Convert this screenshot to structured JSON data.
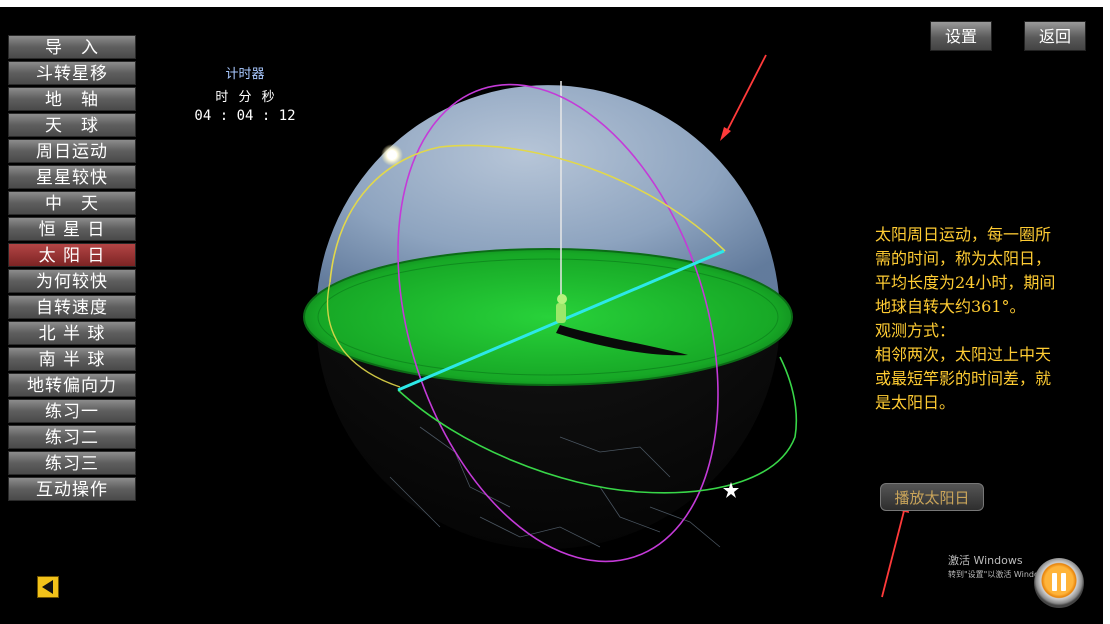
{
  "sidebar": {
    "items": [
      {
        "label": "导　入",
        "name": "sidebar-item-import"
      },
      {
        "label": "斗转星移",
        "name": "sidebar-item-star-movement"
      },
      {
        "label": "地　轴",
        "name": "sidebar-item-earth-axis"
      },
      {
        "label": "天　球",
        "name": "sidebar-item-celestial-sphere"
      },
      {
        "label": "周日运动",
        "name": "sidebar-item-diurnal-motion"
      },
      {
        "label": "星星较快",
        "name": "sidebar-item-stars-faster"
      },
      {
        "label": "中　天",
        "name": "sidebar-item-culmination"
      },
      {
        "label": "恒 星 日",
        "name": "sidebar-item-sidereal-day"
      },
      {
        "label": "太 阳 日",
        "name": "sidebar-item-solar-day",
        "active": true
      },
      {
        "label": "为何较快",
        "name": "sidebar-item-why-faster"
      },
      {
        "label": "自转速度",
        "name": "sidebar-item-rotation-speed"
      },
      {
        "label": "北 半 球",
        "name": "sidebar-item-northern-hemisphere"
      },
      {
        "label": "南 半 球",
        "name": "sidebar-item-southern-hemisphere"
      },
      {
        "label": "地转偏向力",
        "name": "sidebar-item-coriolis-force"
      },
      {
        "label": "练习一",
        "name": "sidebar-item-exercise-1"
      },
      {
        "label": "练习二",
        "name": "sidebar-item-exercise-2"
      },
      {
        "label": "练习三",
        "name": "sidebar-item-exercise-3"
      },
      {
        "label": "互动操作",
        "name": "sidebar-item-interactive"
      }
    ]
  },
  "timer": {
    "title": "计时器",
    "units": "时 分 秒",
    "value": "04 : 04 : 12"
  },
  "toolbar": {
    "settings_label": "设置",
    "return_label": "返回"
  },
  "description": {
    "lines": [
      "太阳周日运动，每一圈所",
      "需的时间，称为太阳日，",
      "平均长度为24小时，期间",
      "地球自转大约361°。",
      "观测方式：",
      "相邻两次，太阳过上中天",
      "或最短竿影的时间差，就",
      "是太阳日。"
    ]
  },
  "play_button": {
    "label": "播放太阳日"
  },
  "watermark": {
    "title": "激活 Windows",
    "subtitle": "转到\"设置\"以激活 Windows。"
  },
  "colors": {
    "sky": "#a6bdd9",
    "horizon_plane": "#1fbe2f",
    "equator_line": "#2de8e8",
    "sun_path": "#e2d84a",
    "meridian": "#c43ad8",
    "star_path": "#38d648",
    "annotation_arrow": "#ff3a3a",
    "description_text": "#ffcc33",
    "active_menu": "#9e3535"
  },
  "icons": {
    "back": "back-arrow-icon",
    "pause": "pause-icon"
  }
}
